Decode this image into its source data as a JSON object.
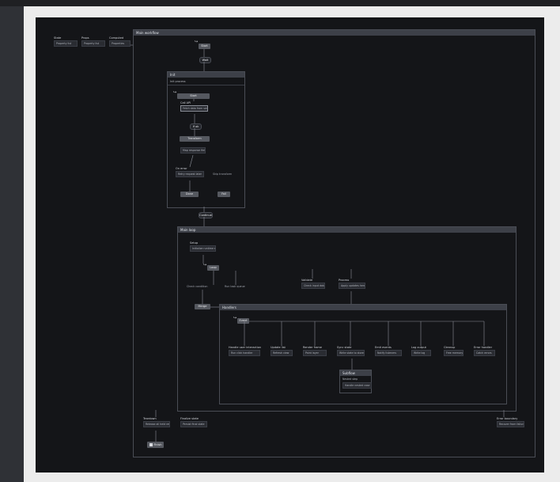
{
  "top_nodes": [
    {
      "title": "State",
      "desc": "Property list"
    },
    {
      "title": "Props",
      "desc": "Property list"
    },
    {
      "title": "Computed",
      "desc": "Properties"
    }
  ],
  "main_frame": {
    "title": "Main workflow",
    "start": "Start"
  },
  "sub1": {
    "title": "Init",
    "header": "Init process",
    "start": "Start",
    "call": {
      "title": "Call API",
      "desc": "Fetch data from server"
    },
    "cond": "If ok",
    "step": {
      "title": "Transform",
      "desc": "Map response fields"
    },
    "notes": {
      "title": "On error",
      "desc": "Retry request later"
    },
    "side": "Skip transform",
    "end_ok": "Done",
    "end_fail": "Fail"
  },
  "mid_pills": {
    "first": "Wait",
    "second": "Continue"
  },
  "sub2": {
    "title": "Main loop",
    "intro": {
      "title": "Setup",
      "desc": "Initialize runtime state"
    },
    "start": "Loop",
    "branches": [
      "Check condition",
      "Run task queue"
    ],
    "aux": [
      {
        "title": "Validate",
        "desc": "Check input data"
      },
      {
        "title": "Process",
        "desc": "Apply updates here"
      }
    ],
    "merge": "Merge",
    "inner": {
      "title": "Handlers",
      "start": "Event",
      "items": [
        {
          "title": "Handle user interaction",
          "desc": "Run click handler"
        },
        {
          "title": "Update list",
          "desc": "Refresh view"
        },
        {
          "title": "Render frame",
          "desc": "Paint layer"
        },
        {
          "title": "Sync state",
          "desc": "Write state to store"
        },
        {
          "title": "Emit events",
          "desc": "Notify listeners"
        },
        {
          "title": "Log output",
          "desc": "Write log"
        },
        {
          "title": "Cleanup",
          "desc": "Free memory"
        },
        {
          "title": "Error handler",
          "desc": "Catch errors"
        }
      ],
      "child": {
        "title": "Subflow",
        "line1": "Nested step",
        "desc": "Handle nested case"
      }
    }
  },
  "bottom": {
    "left": {
      "title": "Teardown",
      "desc": "Release all held resources"
    },
    "mid": {
      "title": "Finalize state",
      "desc": "Persist final state"
    },
    "right": {
      "title": "Error boundary",
      "desc": "Recover from failure"
    },
    "end": "Finish"
  },
  "colors": {
    "board": "#141518",
    "frame_head": "#3d4048",
    "pill": "#55585f",
    "edge": "#8a8e97"
  }
}
